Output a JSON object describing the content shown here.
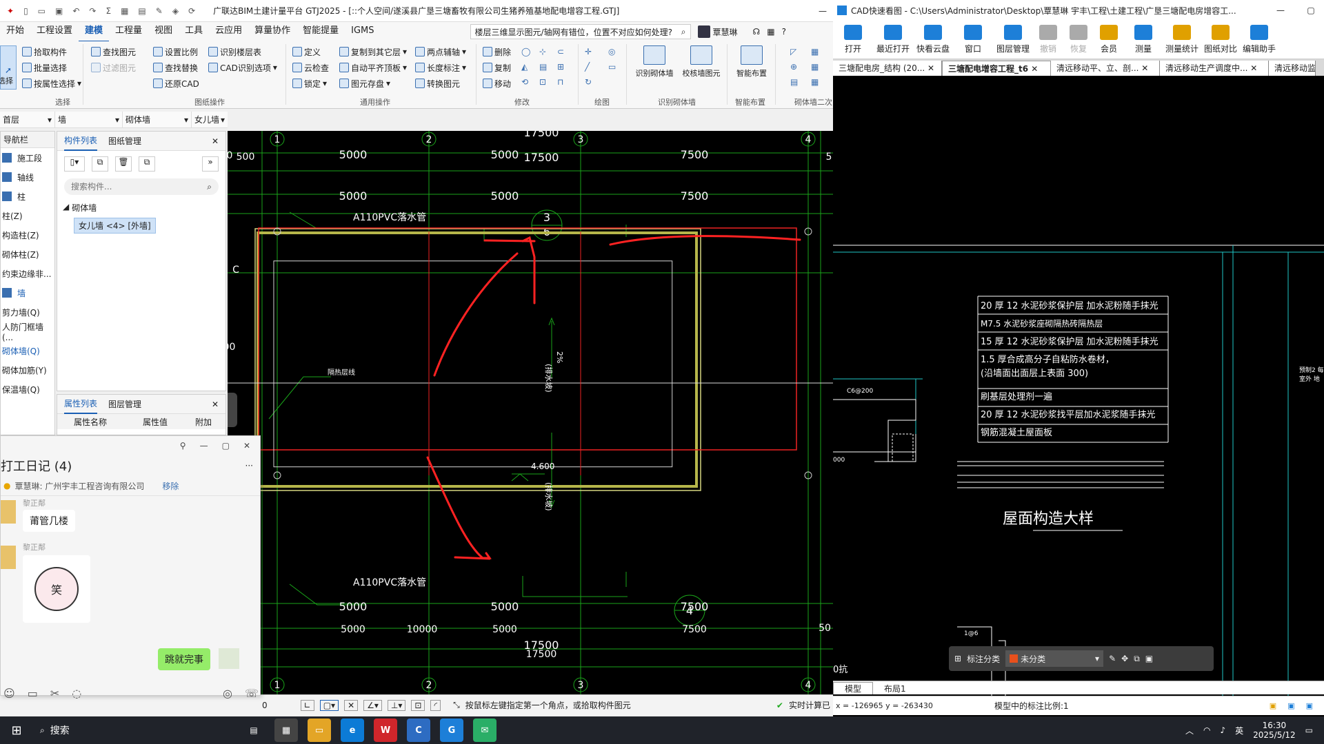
{
  "gtj": {
    "title": "广联达BIM土建计量平台 GTJ2025 - [::个人空间/遂溪县广垦三塘畜牧有限公司生猪养殖基地配电增容工程.GTJ]",
    "menu": [
      "开始",
      "工程设置",
      "建模",
      "工程量",
      "视图",
      "工具",
      "云应用",
      "算量协作",
      "智能提量",
      "IGMS"
    ],
    "active_menu": "建模",
    "search_hint": "楼层三维显示图元/轴网有错位，位置不对应如何处理?",
    "user": "覃慧琳",
    "ribbon": {
      "select": {
        "big": "选择",
        "items": [
          "拾取构件",
          "批量选择",
          "按属性选择"
        ],
        "group": "选择"
      },
      "drawing": {
        "items": [
          "查找图元",
          "过滤图元",
          "设置比例",
          "查找替换",
          "还原CAD",
          "识别楼层表",
          "CAD识别选项"
        ],
        "group": "图纸操作"
      },
      "common": {
        "items": [
          "定义",
          "云检查",
          "锁定",
          "复制到其它层",
          "自动平齐顶板",
          "图元存盘",
          "两点辅轴",
          "长度标注",
          "转换图元"
        ],
        "group": "通用操作"
      },
      "modify": {
        "items": [
          "删除",
          "复制",
          "移动"
        ],
        "group": "修改"
      },
      "draw": {
        "group": "绘图"
      },
      "recog": {
        "items": [
          "识别砌体墙",
          "校核墙图元"
        ],
        "group": "识别砌体墙"
      },
      "smart": {
        "items": [
          "智能布置"
        ],
        "group": "智能布置"
      },
      "wall2": {
        "group": "砌体墙二次"
      }
    },
    "selectors": [
      "首层",
      "墙",
      "砌体墙",
      "女儿墙"
    ],
    "nav": {
      "title": "导航栏",
      "items": [
        "施工段",
        "轴线",
        "柱",
        "柱(Z)",
        "构造柱(Z)",
        "砌体柱(Z)",
        "约束边缘非...",
        "墙",
        "剪力墙(Q)",
        "人防门框墙(...",
        "砌体墙(Q)",
        "砌体加筋(Y)",
        "保温墙(Q)"
      ]
    },
    "component_panel": {
      "tabs": [
        "构件列表",
        "图纸管理"
      ],
      "search_placeholder": "搜索构件...",
      "tree_group": "砌体墙",
      "tree_item": "女儿墙 <4> [外墙]"
    },
    "property_panel": {
      "tabs": [
        "属性列表",
        "图层管理"
      ],
      "columns": [
        "属性名称",
        "属性值",
        "附加"
      ]
    },
    "status": {
      "left": "0",
      "hint": "按鼠标左键指定第一个角点，或拾取构件图元",
      "right": "实时计算已"
    }
  },
  "drawing": {
    "axes_top": [
      "1",
      "2",
      "3",
      "4"
    ],
    "axes_bottom": [
      "1",
      "2",
      "3",
      "4"
    ],
    "axis_left": "C",
    "dims_top_outer": "17500",
    "dims_top_row1": [
      "5000",
      "5000",
      "7500"
    ],
    "dims_top_row2": [
      "5000",
      "5000",
      "7500"
    ],
    "dims_bottom_row1": [
      "5000",
      "5000",
      "7500"
    ],
    "dims_bottom_row2": [
      "5000",
      "10000",
      "5000",
      "7500"
    ],
    "dims_bottom_total": [
      "17500",
      "17500"
    ],
    "side_dims": [
      "500",
      "500",
      "500",
      "50",
      "5"
    ],
    "labels": [
      "A110PVC落水管",
      "A110PVC落水管",
      "隔热层线",
      "4.600",
      "2%",
      "(排水坡)",
      "(排水坡)"
    ],
    "callout_top": [
      "3",
      "6"
    ],
    "callout_bottom": "4"
  },
  "chat": {
    "title": "打工日记 (4)",
    "member": "覃慧琳: 广州宇丰工程咨询有限公司",
    "remove": "移除",
    "messages": [
      {
        "sender": "黎正鄰",
        "text": "莆管几楼"
      },
      {
        "sender": "黎正鄰",
        "sticker": "笑"
      }
    ],
    "my_message": "跳就完事"
  },
  "cad": {
    "title": "CAD快速看图 - C:\\Users\\Administrator\\Desktop\\覃慧琳 宇丰\\工程\\土建工程\\广垦三塘配电房增容工...",
    "tools": [
      "打开",
      "最近打开",
      "快看云盘",
      "窗口",
      "图层管理",
      "撤销",
      "恢复",
      "会员",
      "测量",
      "测量统计",
      "图纸对比",
      "编辑助手"
    ],
    "tabs": [
      "三塘配电房_结构 (20...",
      "三塘配电增容工程_t6",
      "清远移动平、立、剖...",
      "清远移动生产调度中...",
      "清远移动监"
    ],
    "active_tab": 1,
    "detail_lines": [
      "20 厚 12 水泥砂浆保护层   加水泥粉随手抹光",
      "M7.5 水泥砂浆座砌隔热砖隔热层",
      "15 厚 12 水泥砂浆保护层   加水泥粉随手抹光",
      "1.5 厚合成高分子自粘防水卷材，",
      "(沿墙面出面层上表面    300)",
      "刷基层处理剂一遍",
      "20 厚 12 水泥砂浆找平层加水泥浆随手抹光",
      "钢筋混凝土屋面板"
    ],
    "detail_title": "屋面构造大样",
    "side_labels": [
      "预制2 每",
      "室外 地"
    ],
    "small_labels": [
      "C6@200",
      "000",
      "1@6",
      "0抗"
    ],
    "annot_label": "标注分类",
    "annot_value": "未分类",
    "model_tabs": [
      "模型",
      "布局1"
    ],
    "coord": "x = -126965  y = -263430",
    "scale": "模型中的标注比例:1"
  },
  "taskbar": {
    "search": "搜索",
    "time": "16:30",
    "date": "2025/5/12",
    "ime": "英"
  }
}
